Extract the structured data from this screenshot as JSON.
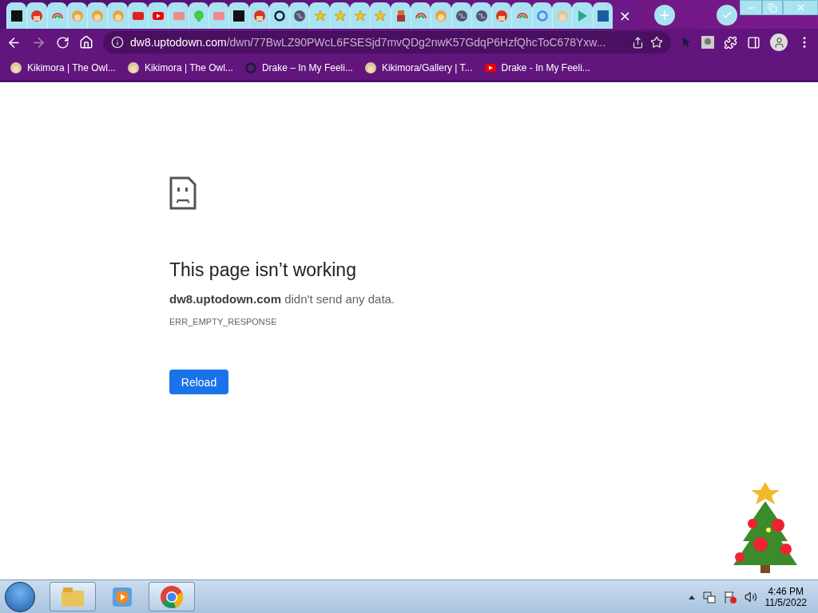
{
  "tabs": [
    {
      "selected": false
    },
    {
      "selected": false
    },
    {
      "selected": false
    },
    {
      "selected": false
    },
    {
      "selected": false
    },
    {
      "selected": false
    },
    {
      "selected": false
    },
    {
      "selected": false
    },
    {
      "selected": false
    },
    {
      "selected": false
    },
    {
      "selected": false
    },
    {
      "selected": false
    },
    {
      "selected": false
    },
    {
      "selected": false
    },
    {
      "selected": false
    },
    {
      "selected": false
    },
    {
      "selected": false
    },
    {
      "selected": false
    },
    {
      "selected": false
    },
    {
      "selected": false
    },
    {
      "selected": false
    },
    {
      "selected": false
    },
    {
      "selected": false
    },
    {
      "selected": false
    },
    {
      "selected": false
    },
    {
      "selected": false
    },
    {
      "selected": false
    },
    {
      "selected": false
    },
    {
      "selected": false
    },
    {
      "selected": false
    },
    {
      "selected": true,
      "close": "×"
    }
  ],
  "address_bar": {
    "domain": "dw8.uptodown.com",
    "path": "/dwn/77BwLZ90PWcL6FSESjd7mvQDg2nwK57GdqP6HzfQhcToC678Yxw..."
  },
  "bookmarks": [
    {
      "label": "Kikimora | The Owl..."
    },
    {
      "label": "Kikimora | The Owl..."
    },
    {
      "label": "Drake – In My Feeli..."
    },
    {
      "label": "Kikimora/Gallery | T..."
    },
    {
      "label": "Drake - In My Feeli..."
    }
  ],
  "error_page": {
    "title": "This page isn’t working",
    "message": "**dw8.uptodown.com** didn't send any data.",
    "code": "ERR_EMPTY_RESPONSE",
    "button": "Reload"
  },
  "taskbar": {
    "apps": [
      {
        "running": true
      },
      {
        "running": false
      },
      {
        "running": true
      }
    ],
    "time": "4:46 PM",
    "date": "11/5/2022"
  }
}
